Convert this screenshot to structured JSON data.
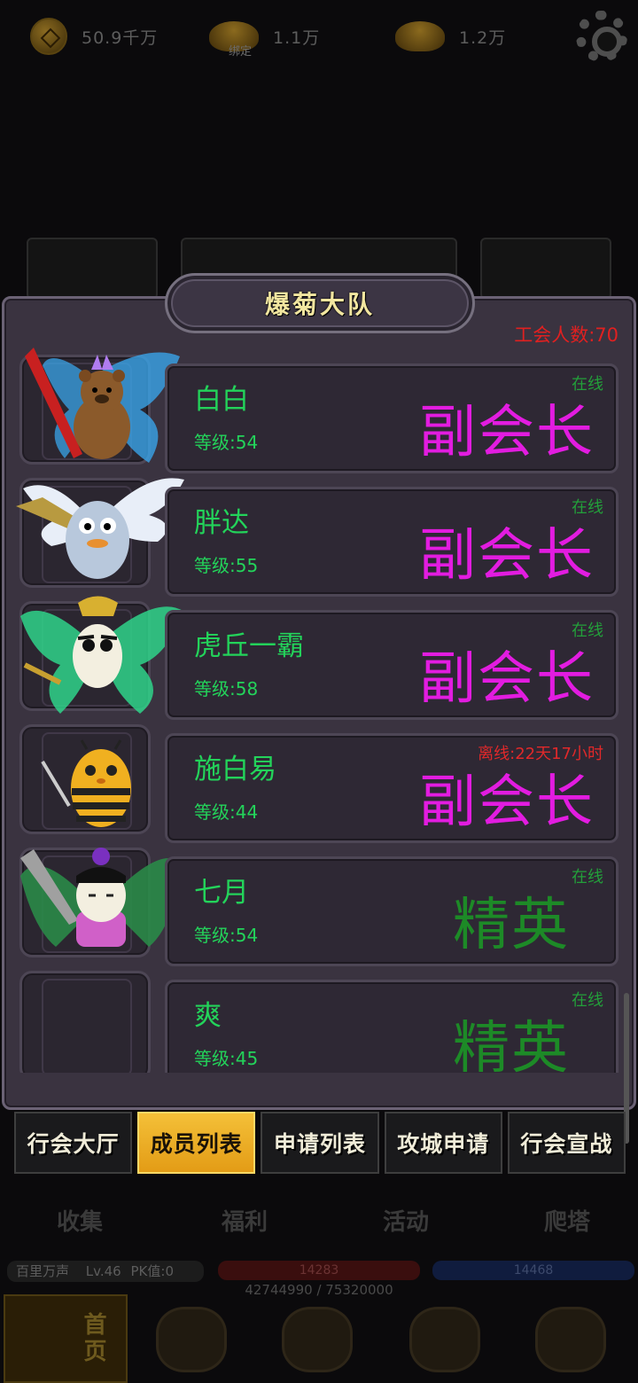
{
  "topbar": {
    "currencies": [
      {
        "icon": "copper-coin-icon",
        "amount": "50.9千万"
      },
      {
        "icon": "bound-ingot-icon",
        "tag": "绑定",
        "amount": "1.1万"
      },
      {
        "icon": "gold-ingot-icon",
        "amount": "1.2万"
      }
    ],
    "settings_icon": "gear-icon"
  },
  "dialog": {
    "title": "爆菊大队",
    "member_count": "工会人数:70",
    "members": [
      {
        "name": "白白",
        "level": "等级:54",
        "status": "在线",
        "rank": "副会长",
        "rank_type": "vice"
      },
      {
        "name": "胖达",
        "level": "等级:55",
        "status": "在线",
        "rank": "副会长",
        "rank_type": "vice"
      },
      {
        "name": "虎丘一霸",
        "level": "等级:58",
        "status": "在线",
        "rank": "副会长",
        "rank_type": "vice"
      },
      {
        "name": "施白易",
        "level": "等级:44",
        "status": "离线:22天17小时",
        "rank": "副会长",
        "rank_type": "vice"
      },
      {
        "name": "七月",
        "level": "等级:54",
        "status": "在线",
        "rank": "精英",
        "rank_type": "elite"
      },
      {
        "name": "爽",
        "level": "等级:45",
        "status": "在线",
        "rank": "精英",
        "rank_type": "elite"
      }
    ]
  },
  "tabs": [
    {
      "label": "行会大厅",
      "active": false
    },
    {
      "label": "成员列表",
      "active": true
    },
    {
      "label": "申请列表",
      "active": false
    },
    {
      "label": "攻城申请",
      "active": false
    },
    {
      "label": "行会宣战",
      "active": false
    }
  ],
  "sub_tabs": [
    "收集",
    "福利",
    "活动",
    "爬塔"
  ],
  "player": {
    "name": "百里万声",
    "level": "Lv.46",
    "pk": "PK值:0",
    "hp": "14283",
    "mp": "14468",
    "exp": "42744990 / 75320000"
  },
  "bottom_nav": {
    "home_label": "首页"
  },
  "colors": {
    "vice_rank": "#e21ce0",
    "elite_rank": "#1d8a27",
    "online": "#239f3a",
    "offline": "#e0282a",
    "name_green": "#23d35a",
    "active_tab": "#f4c038"
  }
}
